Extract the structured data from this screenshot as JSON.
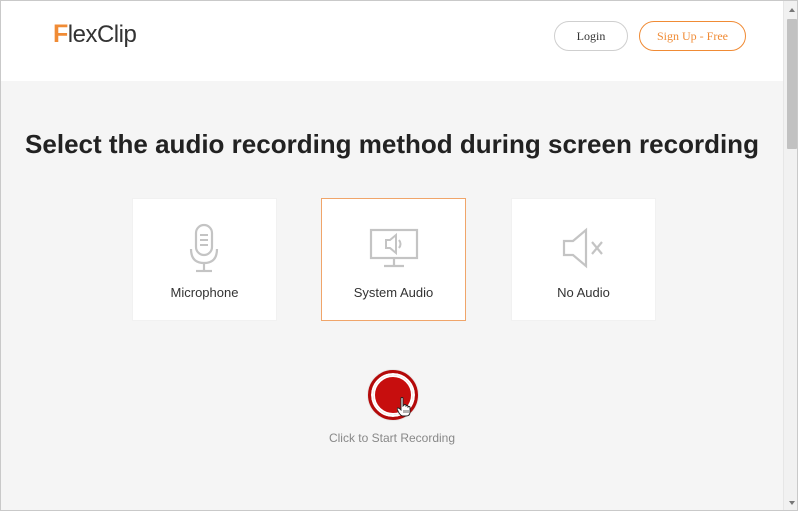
{
  "header": {
    "logo_first": "F",
    "logo_rest": "lexClip",
    "login_label": "Login",
    "signup_label": "Sign Up - Free"
  },
  "main": {
    "heading": "Select the audio recording method during screen recording",
    "options": [
      {
        "label": "Microphone",
        "icon": "microphone-icon",
        "selected": false
      },
      {
        "label": "System Audio",
        "icon": "monitor-speaker-icon",
        "selected": true
      },
      {
        "label": "No Audio",
        "icon": "speaker-muted-icon",
        "selected": false
      }
    ],
    "record_caption": "Click to Start Recording"
  },
  "colors": {
    "brand_orange": "#f08b35",
    "record_red": "#c90d0d",
    "background": "#f5f5f5"
  }
}
